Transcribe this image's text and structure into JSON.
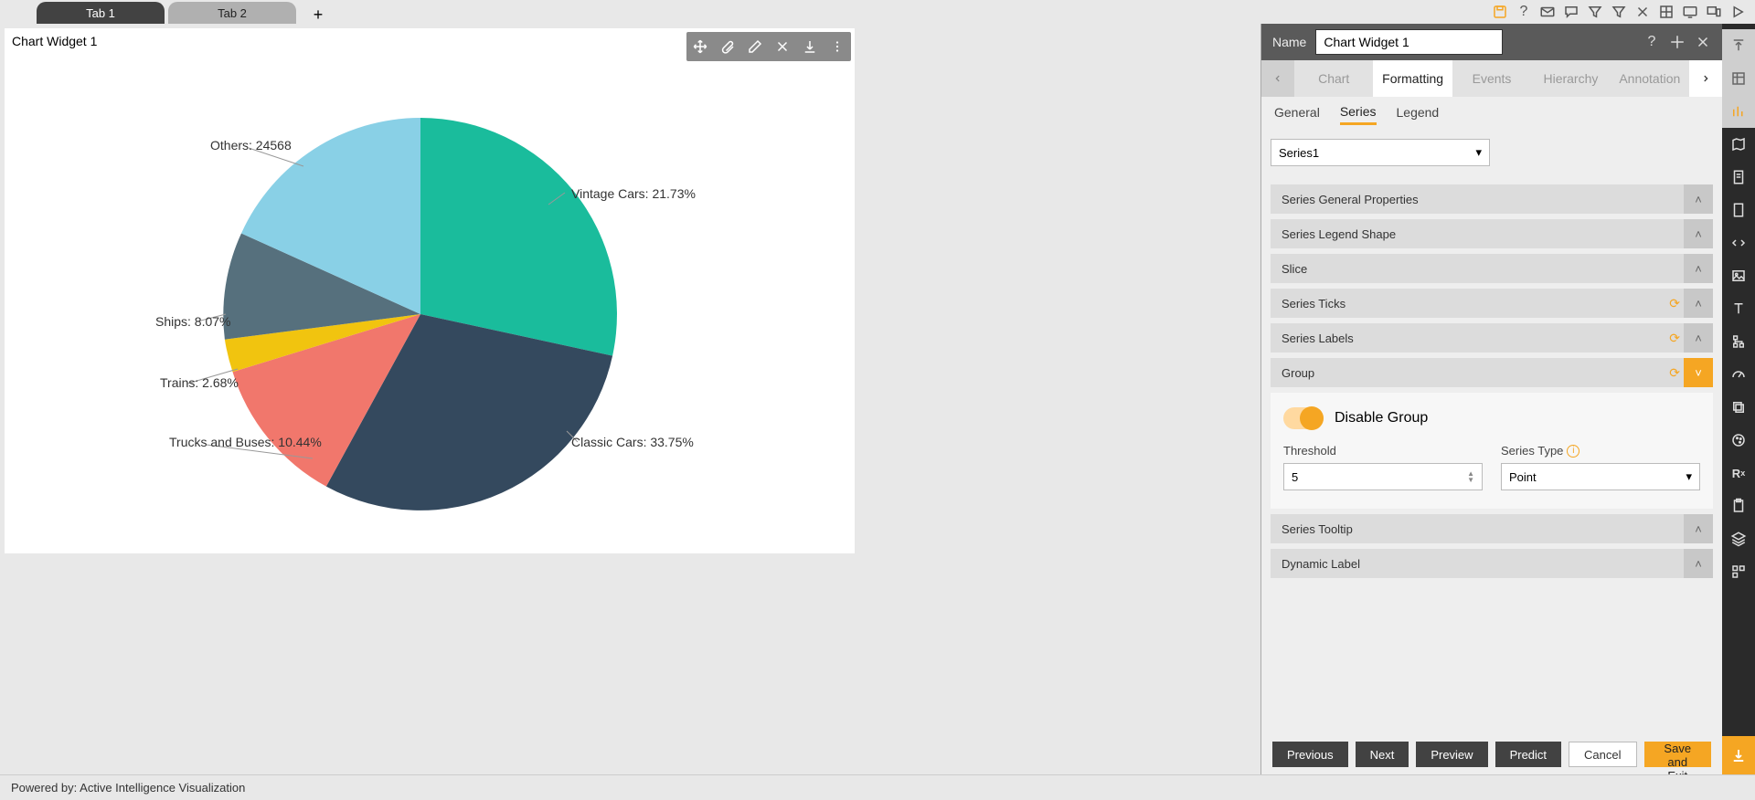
{
  "tabs": {
    "tab1": "Tab 1",
    "tab2": "Tab 2"
  },
  "widget": {
    "title": "Chart Widget 1"
  },
  "chart_data": {
    "type": "pie",
    "title": "",
    "series": [
      {
        "name": "Vintage Cars",
        "percent": 21.73,
        "color": "#1abc9c"
      },
      {
        "name": "Classic Cars",
        "percent": 33.75,
        "color": "#34495e"
      },
      {
        "name": "Trucks and Buses",
        "percent": 10.44,
        "color": "#f1776c"
      },
      {
        "name": "Trains",
        "percent": 2.68,
        "color": "#f1c40f"
      },
      {
        "name": "Ships",
        "percent": 8.07,
        "color": "#56707d"
      },
      {
        "name": "Others",
        "value": 24568,
        "color": "#89d0e6"
      }
    ],
    "labels": {
      "vintage": "Vintage Cars: 21.73%",
      "classic": "Classic Cars: 33.75%",
      "trucks": "Trucks and Buses: 10.44%",
      "trains": "Trains: 2.68%",
      "ships": "Ships: 8.07%",
      "others": "Others: 24568"
    }
  },
  "panel": {
    "name_label": "Name",
    "name_value": "Chart Widget 1",
    "tabs": {
      "chart": "Chart",
      "formatting": "Formatting",
      "events": "Events",
      "hierarchy": "Hierarchy",
      "annotation": "Annotation"
    },
    "subtabs": {
      "general": "General",
      "series": "Series",
      "legend": "Legend"
    },
    "series_select": "Series1",
    "accordions": {
      "general_props": "Series General Properties",
      "legend_shape": "Series Legend Shape",
      "slice": "Slice",
      "ticks": "Series Ticks",
      "labels": "Series Labels",
      "group": "Group",
      "tooltip": "Series Tooltip",
      "dynamic": "Dynamic Label"
    },
    "group_body": {
      "disable_label": "Disable Group",
      "threshold_label": "Threshold",
      "threshold_value": "5",
      "series_type_label": "Series Type",
      "series_type_value": "Point"
    },
    "footer": {
      "previous": "Previous",
      "next": "Next",
      "preview": "Preview",
      "predict": "Predict",
      "cancel": "Cancel",
      "save": "Save and Exit"
    }
  },
  "footer_text": "Powered by: Active Intelligence Visualization"
}
